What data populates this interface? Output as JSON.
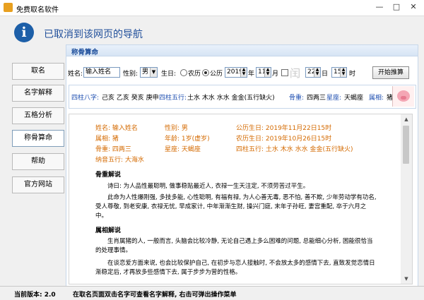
{
  "window": {
    "title": "免费取名软件",
    "min": "—",
    "max": "□",
    "close": "✕"
  },
  "banner": {
    "message": "已取消到该网页的导航"
  },
  "nav": [
    {
      "label": "取名"
    },
    {
      "label": "名字解释"
    },
    {
      "label": "五格分析"
    },
    {
      "label": "称骨算命"
    },
    {
      "label": "帮助"
    },
    {
      "label": "官方网站"
    }
  ],
  "panel": {
    "title": "称骨算命"
  },
  "form": {
    "name_label": "姓名:",
    "name_value": "输入姓名",
    "gender_label": "性别:",
    "gender_value": "男",
    "birth_label": "生日:",
    "lunar_label": "农历",
    "solar_label": "公历",
    "year": "2019",
    "year_unit": "年",
    "month": "11",
    "month_unit": "月",
    "run_char": "闰",
    "day": "22",
    "day_unit": "日",
    "hour": "15",
    "hour_unit": "时",
    "start_button": "开始推算"
  },
  "summary": {
    "bazi_label": "四柱八字:",
    "bazi_value": "己亥 乙亥 癸亥 庚申",
    "wuxing_label": "四柱五行:",
    "wuxing_value": "土水 木水 水水 金金(五行缺火)",
    "bone_label": "骨重:",
    "bone_value": "四两三",
    "star_label": "星座:",
    "star_value": "天蝎座",
    "zodiac_label": "属相:",
    "zodiac_value": "猪"
  },
  "detail": {
    "name": "姓名: 输入姓名",
    "gender": "性别: 男",
    "solar": "公历生日: 2019年11月22日15时",
    "zodiac": "属相: 猪",
    "age": "年龄: 1岁(虚岁)",
    "lunar": "农历生日: 2019年10月26日15时",
    "bone": "骨重: 四两三",
    "star": "星座: 天蝎座",
    "wuxing": "四柱五行: 土水 木水 水水 金金(五行缺火)",
    "nayin": "纳音五行: 大海水",
    "sec1": "骨重解说",
    "poem": "诗曰: 为人品性最聪明, 做事稳贴最近人, 衣禄一生天注定, 不须劳苦过平生。",
    "para1": "此命为人性爆刚强, 多技多能, 心性聪明, 有福有禄, 为人心善无毒, 恶不怕, 善不欺, 少年劳动学有功名, 受人尊敬, 到老安康, 衣禄无忧, 早成家计, 中年渐渐生财, 操兴门庭, 末年子孙旺, 妻宫重配, 卒于六月之中。",
    "sec2": "属相解说",
    "para2": "生肖属猪的人, 一般而言, 头脑会比较冷静, 无论自己遇上多么困难的问题, 总能细心分析, 困能很恰当的处理事情。",
    "para3": "在谈恋爱方面来说, 也会比较保护自己, 在初步与恋人接触时, 不会放太多的感情下去, 直致发觉恋情日渐稳定后, 才再放多些感情下去, 属于步步为营的性格。"
  },
  "status": {
    "version": "当前版本: 2.0",
    "hint": "在取名页面双击名字可查看名字解释, 右击可弹出操作菜单"
  }
}
